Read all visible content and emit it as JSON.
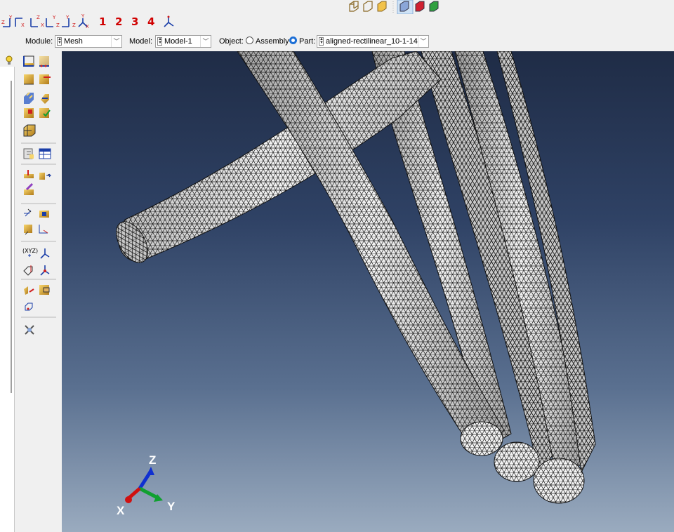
{
  "toolbar": {
    "view_buttons": [
      "view-x-icon",
      "view-y-icon",
      "view-z-icon",
      "view-neg-y-icon",
      "view-iso-icon"
    ],
    "numbered_views": [
      "1",
      "2",
      "3",
      "4"
    ],
    "render_buttons": [
      "wireframe-icon",
      "hidden-lines-icon",
      "shaded-icon",
      "mesh-display-icon",
      "mesh-highlight-icon",
      "mesh-green-icon"
    ]
  },
  "context": {
    "module_label": "Module:",
    "module_value": "Mesh",
    "model_label": "Model:",
    "model_value": "Model-1",
    "object_label": "Object:",
    "assembly_label": "Assembly",
    "part_label": "Part:",
    "part_value": "aligned-rectilinear_10-1-14",
    "object_selected": "Part"
  },
  "triad": {
    "x": "X",
    "y": "Y",
    "z": "Z"
  },
  "colors": {
    "viewport_top": "#1f2c46",
    "viewport_bottom": "#9aabbf",
    "axis_x": "#d01010",
    "axis_y": "#10a030",
    "axis_z": "#1030d0",
    "accent": "#1d6fd6"
  }
}
